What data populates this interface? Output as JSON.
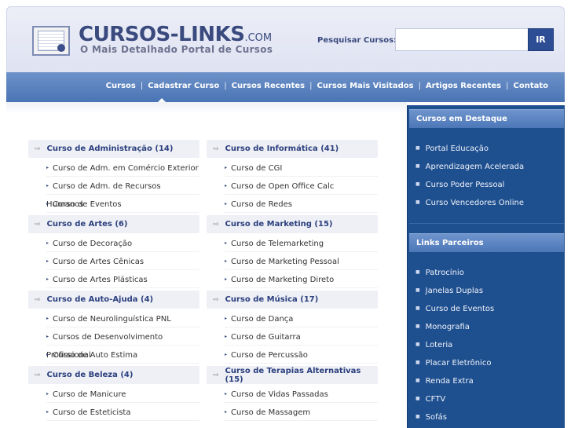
{
  "header": {
    "logo_title": "CURSOS-LINKS",
    "logo_suffix": ".COM",
    "logo_subtitle": "O Mais Detalhado Portal de Cursos",
    "search_label": "Pesquisar Cursos:",
    "search_value": "",
    "search_button": "IR"
  },
  "nav": {
    "items": [
      {
        "label": "Cursos",
        "active": true
      },
      {
        "label": "Cadastrar Curso"
      },
      {
        "label": "Cursos Recentes"
      },
      {
        "label": "Cursos Mais Visitados"
      },
      {
        "label": "Artigos Recentes"
      },
      {
        "label": "Contato"
      }
    ]
  },
  "categories": {
    "col1": [
      {
        "title": "Curso de Administração (14)",
        "items": [
          "Curso de Adm. em Comércio Exterior",
          "Curso de Adm. de Recursos Humanos",
          "Curso de Eventos"
        ]
      },
      {
        "title": "Curso de Artes (6)",
        "items": [
          "Curso de Decoração",
          "Curso de Artes Cênicas",
          "Curso de Artes Plásticas"
        ]
      },
      {
        "title": "Curso de Auto-Ajuda (4)",
        "items": [
          "Curso de Neurolinguística PNL",
          "Cursos de Desenvolvimento Profissional",
          "Curso de Auto Estima"
        ]
      },
      {
        "title": "Curso de Beleza (4)",
        "items": [
          "Curso de Manicure",
          "Curso de Esteticista"
        ]
      }
    ],
    "col2": [
      {
        "title": "Curso de Informática (41)",
        "items": [
          "Curso de CGI",
          "Curso de Open Office Calc",
          "Curso de Redes"
        ]
      },
      {
        "title": "Curso de Marketing (15)",
        "items": [
          "Curso de Telemarketing",
          "Curso de Marketing Pessoal",
          "Curso de Marketing Direto"
        ]
      },
      {
        "title": "Curso de Música (17)",
        "items": [
          "Curso de Dança",
          "Curso de Guitarra",
          "Curso de Percussão"
        ]
      },
      {
        "title": "Curso de Terapias Alternativas (15)",
        "items": [
          "Curso de Vidas Passadas",
          "Curso de Massagem"
        ]
      }
    ]
  },
  "sidebar": {
    "featured_title": "Cursos em Destaque",
    "featured": [
      "Portal Educação",
      "Aprendizagem Acelerada",
      "Curso Poder Pessoal",
      "Curso Vencedores Online"
    ],
    "partners_title": "Links Parceiros",
    "partners": [
      "Patrocínio",
      "Janelas Duplas",
      "Curso de Eventos",
      "Monografia",
      "Loteria",
      "Placar Eletrônico",
      "Renda Extra",
      "CFTV",
      "Sofás"
    ]
  }
}
